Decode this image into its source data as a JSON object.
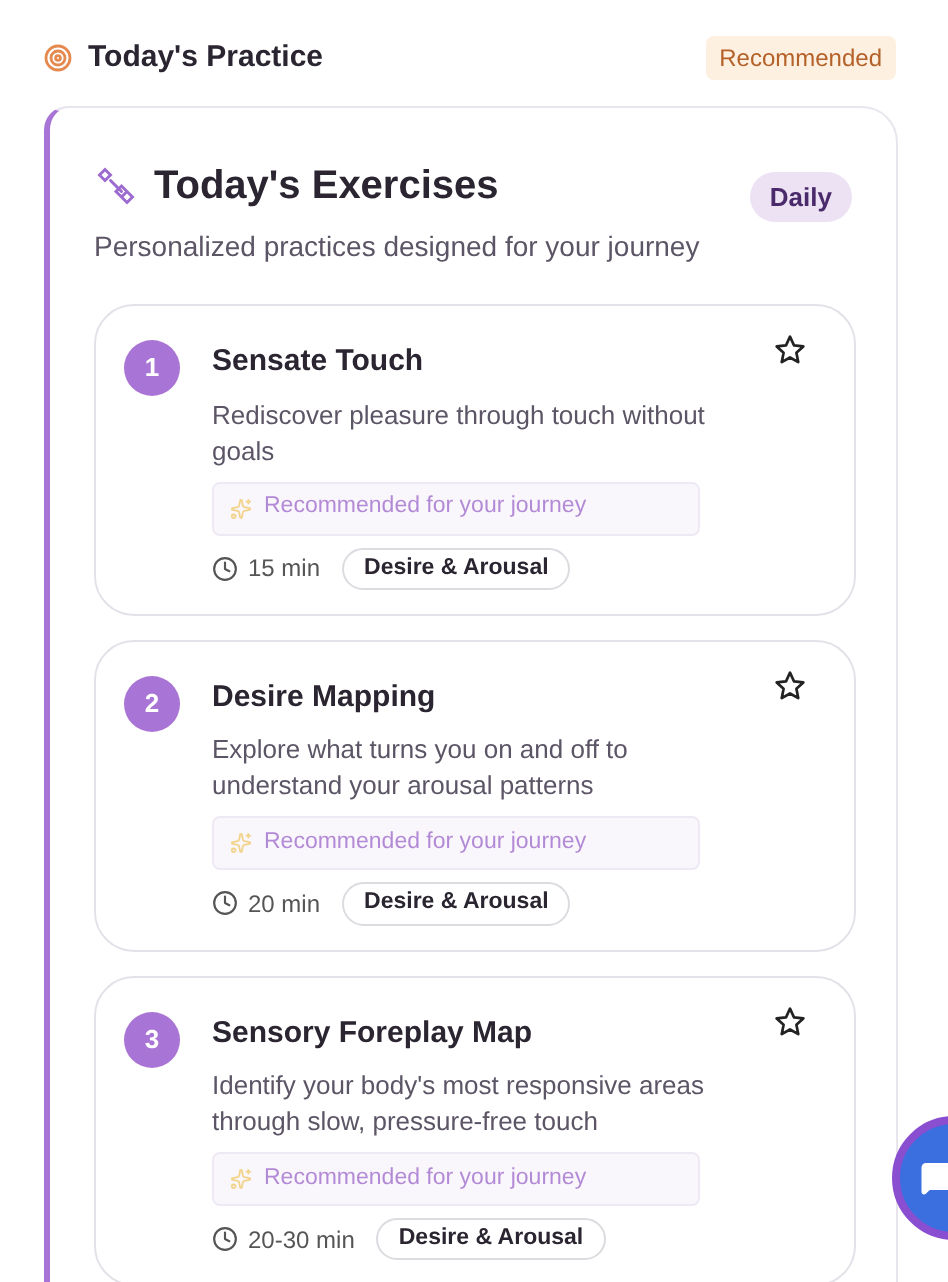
{
  "header": {
    "title": "Today's Practice",
    "badge": "Recommended"
  },
  "panel": {
    "title": "Today's Exercises",
    "subtitle": "Personalized practices designed for your journey",
    "badge": "Daily"
  },
  "exercises": [
    {
      "number": "1",
      "title": "Sensate Touch",
      "description": "Rediscover pleasure through touch without goals",
      "note": "Recommended for your journey",
      "duration": "15 min",
      "tag": "Desire & Arousal"
    },
    {
      "number": "2",
      "title": "Desire Mapping",
      "description": "Explore what turns you on and off to understand your arousal patterns",
      "note": "Recommended for your journey",
      "duration": "20 min",
      "tag": "Desire & Arousal"
    },
    {
      "number": "3",
      "title": "Sensory Foreplay Map",
      "description": "Identify your body's most responsive areas through slow, pressure-free touch",
      "note": "Recommended for your journey",
      "duration": "20-30 min",
      "tag": "Desire & Arousal"
    }
  ]
}
